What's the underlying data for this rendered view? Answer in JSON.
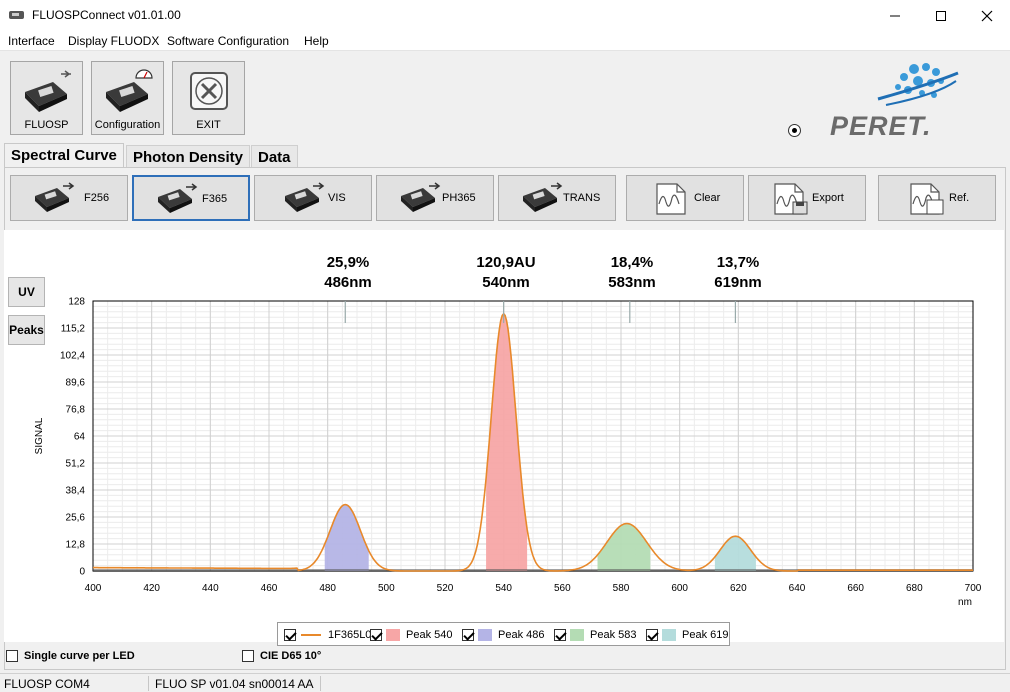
{
  "window": {
    "title": "FLUOSPConnect v01.01.00",
    "minimize_icon": "minimize-icon",
    "maximize_icon": "maximize-icon",
    "close_icon": "close-icon"
  },
  "menu": [
    "Interface",
    "Display FLUODX",
    "Software Configuration",
    "Help"
  ],
  "toolbar": {
    "buttons": [
      {
        "label": "FLUOSP",
        "icon": "usb-device-icon"
      },
      {
        "label": "Configuration",
        "icon": "device-gauge-icon"
      },
      {
        "label": "EXIT",
        "icon": "exit-x-icon"
      }
    ],
    "logo_text": "PERET."
  },
  "tabs": [
    "Spectral Curve",
    "Photon Density",
    "Data"
  ],
  "led_buttons": [
    {
      "label": "F256",
      "icon": "led-device-icon"
    },
    {
      "label": "F365",
      "icon": "led-device-icon"
    },
    {
      "label": "VIS",
      "icon": "led-device-icon"
    },
    {
      "label": "PH365",
      "icon": "led-device-icon"
    },
    {
      "label": "TRANS",
      "icon": "led-device-icon"
    },
    {
      "label": "Clear",
      "icon": "clear-doc-icon"
    },
    {
      "label": "Export",
      "icon": "export-doc-icon"
    },
    {
      "label": "Ref.",
      "icon": "ref-doc-icon"
    }
  ],
  "side_buttons": [
    "UV",
    "Peaks"
  ],
  "peak_labels": [
    {
      "value": "25,9%",
      "wl": "486nm"
    },
    {
      "value": "120,9AU",
      "wl": "540nm"
    },
    {
      "value": "18,4%",
      "wl": "583nm"
    },
    {
      "value": "13,7%",
      "wl": "619nm"
    }
  ],
  "chart_data": {
    "type": "line",
    "ylabel": "SIGNAL",
    "x_unit": "nm",
    "xlim": [
      400,
      700
    ],
    "ylim": [
      0,
      128
    ],
    "x_ticks": [
      "400",
      "420",
      "440",
      "460",
      "480",
      "500",
      "520",
      "540",
      "560",
      "580",
      "600",
      "620",
      "640",
      "660",
      "680",
      "700"
    ],
    "y_ticks": [
      "0",
      "12,8",
      "25,6",
      "38,4",
      "51,2",
      "64",
      "76,8",
      "89,6",
      "102,4",
      "115,2",
      "128"
    ],
    "grid": true,
    "series_color": "#e8892b",
    "peaks": [
      {
        "name": "Peak 540",
        "center": 540,
        "height": 122,
        "band": [
          534,
          548
        ],
        "color": "#f7a6a6"
      },
      {
        "name": "Peak 486",
        "center": 486,
        "height": 31.5,
        "band": [
          479,
          494
        ],
        "color": "#b4b4e6"
      },
      {
        "name": "Peak 583",
        "center": 582,
        "height": 22.5,
        "band": [
          572,
          590
        ],
        "color": "#b4dcb4"
      },
      {
        "name": "Peak 619",
        "center": 619,
        "height": 16.5,
        "band": [
          612,
          626
        ],
        "color": "#b4dcdc"
      }
    ]
  },
  "legend": [
    {
      "label": "1F365L0",
      "checked": true,
      "kind": "line"
    },
    {
      "label": "Peak 540",
      "checked": true,
      "color": "#f7a6a6"
    },
    {
      "label": "Peak 486",
      "checked": true,
      "color": "#b4b4e6"
    },
    {
      "label": "Peak 583",
      "checked": true,
      "color": "#b4dcb4"
    },
    {
      "label": "Peak 619",
      "checked": true,
      "color": "#b4dcdc"
    }
  ],
  "options": {
    "single_curve": "Single curve per LED",
    "cie": "CIE D65 10°"
  },
  "status": {
    "port": "FLUOSP COM4",
    "device": "FLUO SP v01.04 sn00014 AA"
  }
}
